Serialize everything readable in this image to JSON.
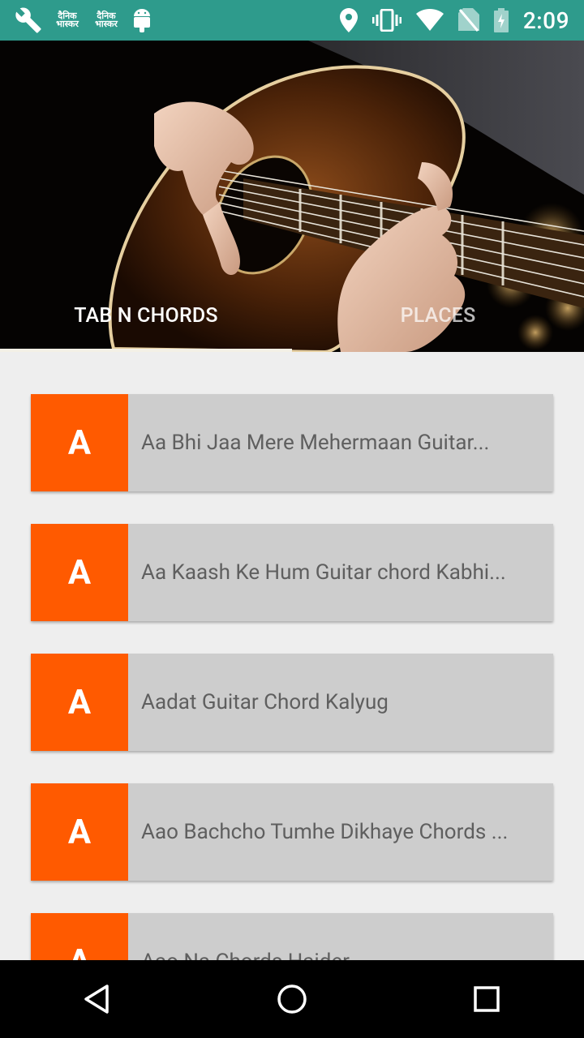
{
  "status_bar": {
    "time": "2:09",
    "news_label_1": "दैनिक भास्कर",
    "news_label_2": "दैनिक भास्कर"
  },
  "tabs": [
    {
      "label": "TAB N CHORDS",
      "active": true
    },
    {
      "label": "PLACES",
      "active": false
    }
  ],
  "songs": [
    {
      "letter": "A",
      "title": "Aa Bhi Jaa Mere Mehermaan Guitar..."
    },
    {
      "letter": "A",
      "title": "Aa Kaash Ke Hum Guitar chord  Kabhi..."
    },
    {
      "letter": "A",
      "title": "Aadat Guitar Chord  Kalyug"
    },
    {
      "letter": "A",
      "title": "Aao Bachcho Tumhe Dikhaye Chords ..."
    },
    {
      "letter": "A",
      "title": "Aao Na Chords  Haider"
    }
  ],
  "colors": {
    "status_bar": "#2e9b8c",
    "accent": "#ff5a00",
    "card": "#cdcdcd"
  }
}
